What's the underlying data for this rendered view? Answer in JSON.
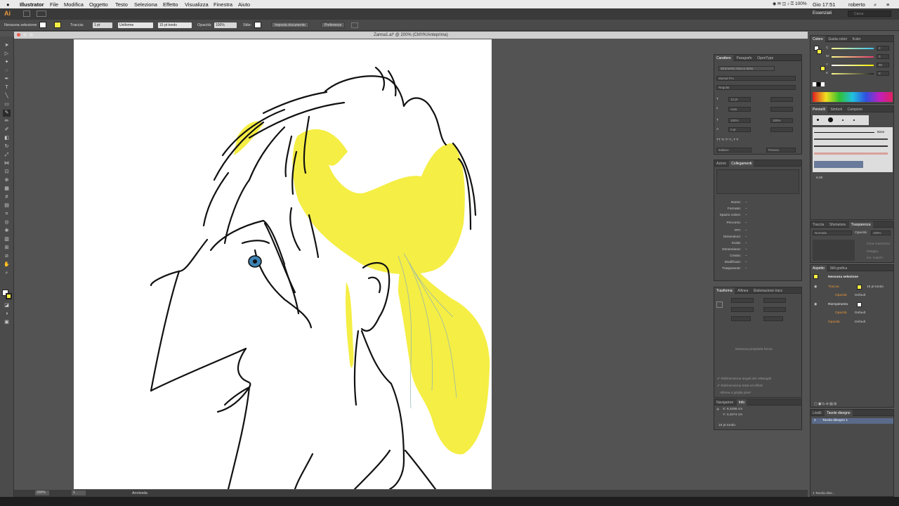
{
  "menubar": {
    "apple": "",
    "items": [
      "Illustrator",
      "File",
      "Modifica",
      "Oggetto",
      "Testo",
      "Seleziona",
      "Effetto",
      "Visualizza",
      "Finestra",
      "Aiuto"
    ],
    "battery": "100%",
    "clock": "Gio 17:51",
    "user": "roberto"
  },
  "appbar": {
    "logo": "Ai",
    "workspace": "Essenziali",
    "search_placeholder": "Cerca"
  },
  "control": {
    "selection": "Nessuna selezione",
    "stroke_label": "Traccia:",
    "stroke_weight": "1 pt",
    "profile": "Uniforme",
    "brush": "15 pt tondo",
    "opacity_label": "Opacità:",
    "opacity": "100%",
    "style_label": "Stile:",
    "doc_setup": "Imposta documento",
    "prefs": "Preferenze"
  },
  "document": {
    "title": "Zanna1.ai* @ 200% (CMYK/Anteprima)"
  },
  "status": {
    "zoom": "200%",
    "page": "1",
    "tool": "Arrotonda"
  },
  "character_panel": {
    "tabs": [
      "Carattere",
      "Paragrafo",
      "OpenType"
    ],
    "touch_tool": "Strumento ritocco testo",
    "font": "Myriad Pro",
    "style": "Regular",
    "size": "12 pt",
    "leading": "Auto",
    "vscale": "100%",
    "hscale": "100%",
    "baseline": "0 pt",
    "language": "Italiano",
    "aa": "Preciso",
    "tt": [
      "TT",
      "Tr",
      "T¹",
      "T₁",
      "T",
      "Ŧ"
    ]
  },
  "links_panel": {
    "tabs": [
      "Azioni",
      "Collegamenti"
    ],
    "rows": [
      "Nome:",
      "Formato:",
      "Spazio colore:",
      "Percorso:",
      "PPI:",
      "Dimensioni:",
      "Scala:",
      "Dimensione:",
      "Creato:",
      "Modificato:",
      "Trasparente:"
    ],
    "dash": "–"
  },
  "transform_panel": {
    "tabs": [
      "Trasforma",
      "Allinea",
      "Elaborazione tracc"
    ],
    "empty": "Nessuna proprietà forma",
    "checks": [
      "Ridimensiona angoli dei rettangoli",
      "Ridimensiona tratti ed effetti",
      "Allinea a griglia pixel"
    ]
  },
  "info_panel": {
    "tabs": [
      "Navigatore",
      "Info"
    ],
    "x": "X: 9,3486 cm",
    "y": "Y: 4,4274 cm",
    "brush": "15 pt tondo"
  },
  "color_panel": {
    "tabs": [
      "Colore",
      "Guida colori",
      "Kuler"
    ],
    "channels": [
      {
        "label": "C",
        "value": "0"
      },
      {
        "label": "M",
        "value": "0"
      },
      {
        "label": "Y",
        "value": "90"
      },
      {
        "label": "K",
        "value": "0"
      }
    ]
  },
  "brushes_panel": {
    "tabs": [
      "Pennelli",
      "Simboli",
      "Campioni"
    ],
    "base": "Base",
    "size": "6,00"
  },
  "transparency_panel": {
    "tabs": [
      "Traccia",
      "Sfumatura",
      "Trasparenza"
    ],
    "mode": "Normale",
    "opacity_label": "Opacità:",
    "opacity": "100%",
    "make_mask": "Crea maschera",
    "clip": "Ritaglia",
    "invert": "Inv. masch."
  },
  "appearance_panel": {
    "tabs": [
      "Aspetto",
      "Stili grafica"
    ],
    "header": "Nessuna selezione",
    "rows": [
      {
        "label": "Traccia",
        "value": "15 pt tondo"
      },
      {
        "label": "Opacità",
        "value": "Default"
      },
      {
        "label": "Riempimento",
        "value": ""
      },
      {
        "label": "Opacità",
        "value": "Default"
      },
      {
        "label": "Opacità",
        "value": "Default"
      }
    ]
  },
  "artboards_panel": {
    "tabs": [
      "Livelli",
      "Tavole disegno"
    ],
    "row_num": "1",
    "row_name": "Tavola disegno 1",
    "footer": "1 Tavola dise..."
  },
  "colors": {
    "yellow": "#f5ee44",
    "panel": "#4a4a4a",
    "accent": "#e6963c"
  }
}
